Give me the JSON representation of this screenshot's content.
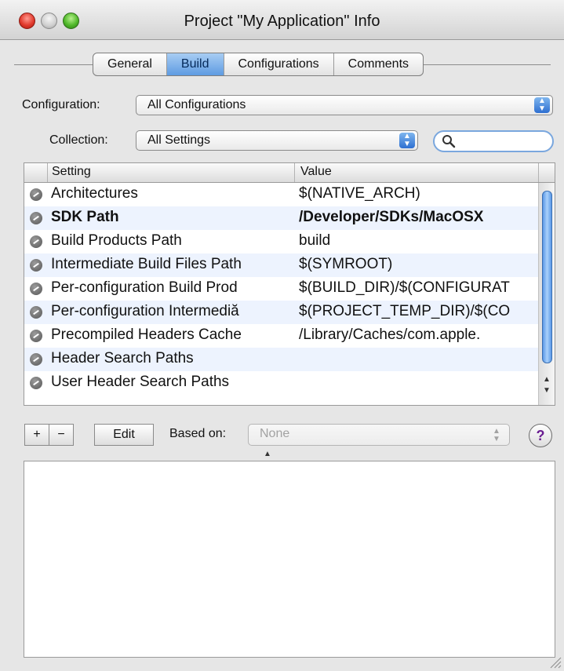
{
  "window": {
    "title": "Project \"My Application\" Info"
  },
  "tabs": [
    {
      "label": "General",
      "active": false
    },
    {
      "label": "Build",
      "active": true
    },
    {
      "label": "Configurations",
      "active": false
    },
    {
      "label": "Comments",
      "active": false
    }
  ],
  "configuration": {
    "label": "Configuration:",
    "value": "All Configurations"
  },
  "collection": {
    "label": "Collection:",
    "value": "All Settings"
  },
  "search": {
    "value": "",
    "placeholder": ""
  },
  "table": {
    "columns": [
      "Setting",
      "Value"
    ],
    "rows": [
      {
        "setting": "Architectures",
        "value": "$(NATIVE_ARCH)"
      },
      {
        "setting": "SDK Path",
        "value": "/Developer/SDKs/MacOSX",
        "bold": true
      },
      {
        "setting": "Build Products Path",
        "value": "build"
      },
      {
        "setting": "Intermediate Build Files Path",
        "value": "$(SYMROOT)"
      },
      {
        "setting": "Per-configuration Build Prod",
        "value": "$(BUILD_DIR)/$(CONFIGURAT"
      },
      {
        "setting": "Per-configuration Intermediă",
        "value": "$(PROJECT_TEMP_DIR)/$(CO"
      },
      {
        "setting": "Precompiled Headers Cache",
        "value": "/Library/Caches/com.apple."
      },
      {
        "setting": "Header Search Paths",
        "value": ""
      },
      {
        "setting": "User Header Search Paths",
        "value": ""
      }
    ]
  },
  "toolbar": {
    "add_label": "+",
    "remove_label": "−",
    "edit_label": "Edit",
    "based_on_label": "Based on:",
    "based_on_value": "None",
    "help_label": "?"
  },
  "colors": {
    "selection_tab": "#5e9be2",
    "alt_row": "#edf3fe",
    "help_glyph": "#6a1d91"
  },
  "icons": [
    "search-icon",
    "row-status-icon",
    "help-icon",
    "resize-grip-icon",
    "up-down-arrows-icon"
  ]
}
